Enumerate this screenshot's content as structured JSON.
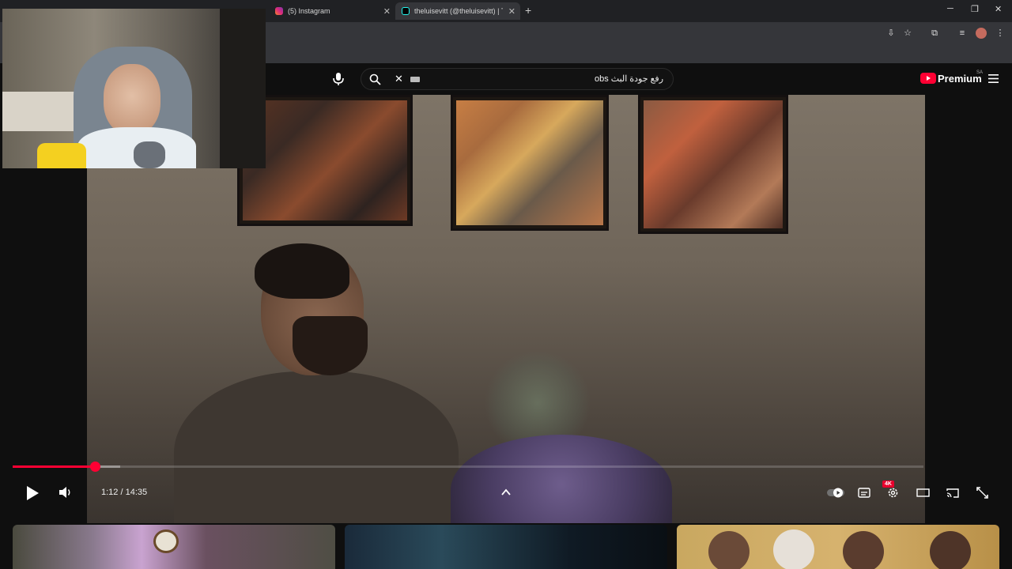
{
  "browser": {
    "tabs": [
      {
        "label": "(5) Instagram",
        "icon": "instagram-icon"
      },
      {
        "label": "theluisevitt (@theluisevitt) | Tik",
        "icon": "tiktok-icon"
      }
    ],
    "new_tab": "+",
    "window_controls": {
      "minimize": "─",
      "restore": "❐",
      "close": "✕"
    }
  },
  "youtube": {
    "search": {
      "query": "رفع جودة البث obs",
      "clear": "✕"
    },
    "logo_text": "Premium",
    "region": "SA"
  },
  "player": {
    "time": "1:12 / 14:35",
    "progress_played_fraction": 0.0902,
    "progress_loaded_fraction": 0.118,
    "quality_badge": "4K"
  },
  "colors": {
    "accent": "#ff0033",
    "background": "#0f0f0f"
  }
}
